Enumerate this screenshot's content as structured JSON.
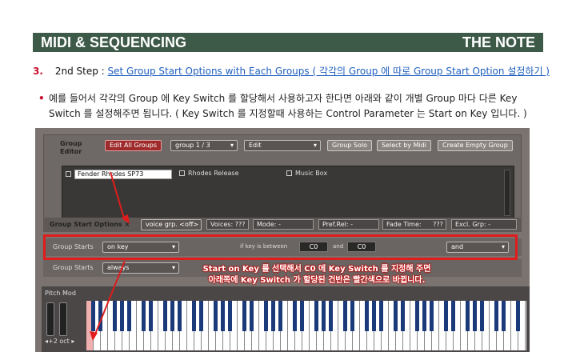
{
  "header": {
    "left": "MIDI & SEQUENCING",
    "right": "THE NOTE"
  },
  "step": {
    "number": "3.",
    "label": "2nd Step :",
    "link": "Set Group Start Options with Each Groups ( 각각의 Group 에 따로 Group Start Option 설정하기 )"
  },
  "bullet": {
    "text": "예를 들어서 각각의 Group 에 Key Switch 를 할당해서 사용하고자 한다면 아래와 같이 개별 Group 마다 다른 Key Switch 를 설정해주면 됩니다. ( Key Switch 를 지정할때 사용하는 Control Parameter 는 Start on Key 입니다. )"
  },
  "editor": {
    "title_line1": "Group",
    "title_line2": "Editor",
    "edit_all": "Edit All Groups",
    "group_select": "group 1 / 3",
    "edit_menu": "Edit",
    "group_solo": "Group Solo",
    "select_by_midi": "Select by Midi",
    "create_empty": "Create Empty Group",
    "groups": [
      "Fender Rhodes SP73",
      "Rhodes Release",
      "Music Box"
    ]
  },
  "options": {
    "title": "Group Start Options ×",
    "voice": "voice grp. <off>",
    "voices": "Voices: ???",
    "mode": "Mode: -",
    "pref_rel": "Pref.Rel: -",
    "fade_time_label": "Fade Time:",
    "fade_time_val": "???",
    "excl_grp": "Excl. Grp: -"
  },
  "row1": {
    "label": "Group Starts",
    "mode": "on key",
    "between": "if key is between",
    "low": "C0",
    "and": "and",
    "high": "C0",
    "logic": "and"
  },
  "row2": {
    "label": "Group Starts",
    "mode": "always"
  },
  "note": {
    "line1": "Start on Key 를 선택해서 C0 에 Key Switch 를 지정해 주면",
    "line2": "아래쪽에 Key Switch 가 할당된 건반은 빨간색으로 바뀝니다."
  },
  "keyboard": {
    "pitch_mod": "Pitch Mod",
    "octave": "◂+2 oct ▸"
  },
  "colors": {
    "header_bg": "#3d5947",
    "step_number": "#c8102e",
    "link": "#1f5fbf",
    "highlight": "#e01c1c"
  }
}
